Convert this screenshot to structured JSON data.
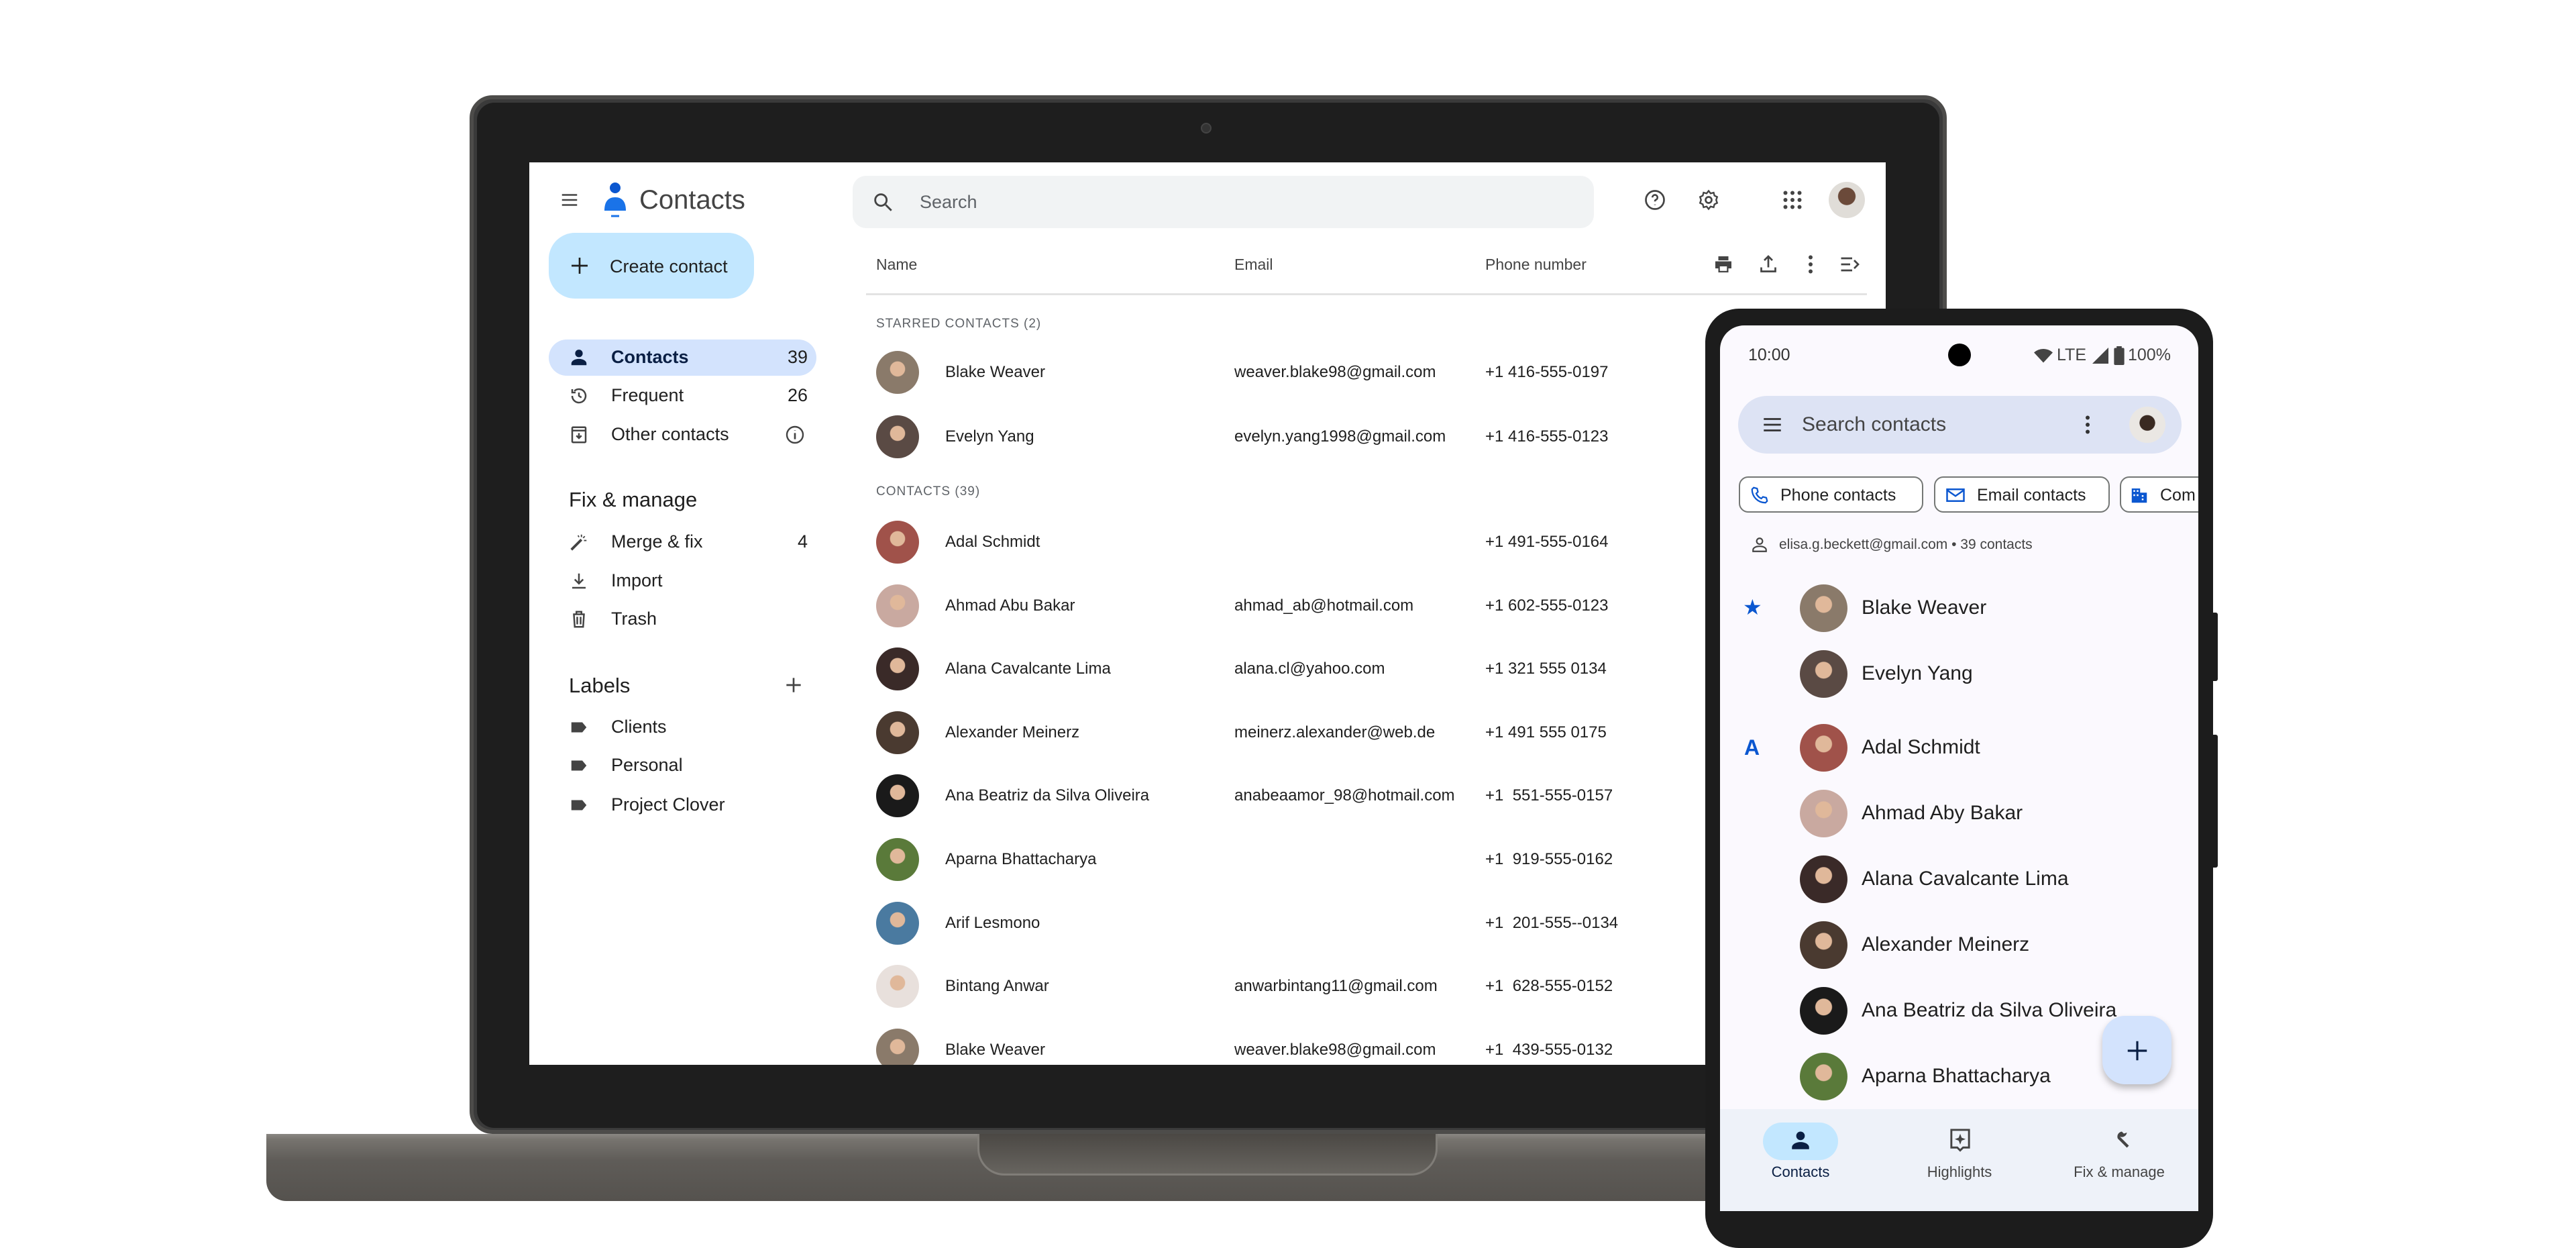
{
  "desktop": {
    "app_title": "Contacts",
    "search_placeholder": "Search",
    "create_contact": "Create contact",
    "nav": [
      {
        "label": "Contacts",
        "count": "39",
        "icon": "person-icon"
      },
      {
        "label": "Frequent",
        "count": "26",
        "icon": "history-icon"
      },
      {
        "label": "Other contacts",
        "icon": "archive-icon",
        "badge_icon": "info-icon"
      }
    ],
    "fix_heading": "Fix & manage",
    "fix_items": [
      {
        "label": "Merge & fix",
        "count": "4",
        "icon": "magic-wand-icon"
      },
      {
        "label": "Import",
        "icon": "download-icon"
      },
      {
        "label": "Trash",
        "icon": "trash-icon"
      }
    ],
    "labels_heading": "Labels",
    "labels": [
      "Clients",
      "Personal",
      "Project Clover"
    ],
    "columns": {
      "name": "Name",
      "email": "Email",
      "phone": "Phone number"
    },
    "starred_heading": "STARRED CONTACTS (2)",
    "contacts_heading": "CONTACTS (39)",
    "starred": [
      {
        "name": "Blake Weaver",
        "email": "weaver.blake98@gmail.com",
        "phone": "+1 416-555-0197",
        "tone": "#8a7a6a"
      },
      {
        "name": "Evelyn Yang",
        "email": "evelyn.yang1998@gmail.com",
        "phone": "+1 416-555-0123",
        "tone": "#5a4a44"
      }
    ],
    "contacts": [
      {
        "name": "Adal Schmidt",
        "email": "",
        "phone": "+1 491-555-0164",
        "tone": "#a0524a"
      },
      {
        "name": "Ahmad Abu Bakar",
        "email": "ahmad_ab@hotmail.com",
        "phone": "+1 602-555-0123",
        "tone": "#c9a9a0"
      },
      {
        "name": "Alana Cavalcante Lima",
        "email": "alana.cl@yahoo.com",
        "phone": "+1 321 555 0134",
        "tone": "#3a2a28"
      },
      {
        "name": "Alexander Meinerz",
        "email": "meinerz.alexander@web.de",
        "phone": "+1 491 555 0175",
        "tone": "#4a3a30"
      },
      {
        "name": "Ana Beatriz da Silva Oliveira",
        "email": "anabeaamor_98@hotmail.com",
        "phone": "+1  551-555-0157",
        "tone": "#1a1a1a"
      },
      {
        "name": "Aparna Bhattacharya",
        "email": "",
        "phone": "+1  919-555-0162",
        "tone": "#5a7a3a"
      },
      {
        "name": "Arif Lesmono",
        "email": "",
        "phone": "+1  201-555--0134",
        "tone": "#4a7aa0"
      },
      {
        "name": "Bintang Anwar",
        "email": "anwarbintang11@gmail.com",
        "phone": "+1  628-555-0152",
        "tone": "#e8e0dc"
      },
      {
        "name": "Blake Weaver",
        "email": "weaver.blake98@gmail.com",
        "phone": "+1  439-555-0132",
        "tone": "#8a7a6a"
      }
    ],
    "colors": {
      "accent": "#0b57d0",
      "create_bg": "#c2e7ff",
      "selected_bg": "#d3e3fd"
    }
  },
  "mobile": {
    "time": "10:00",
    "network": "LTE",
    "battery": "100%",
    "search_placeholder": "Search contacts",
    "chips": [
      {
        "label": "Phone contacts",
        "icon": "phone-icon"
      },
      {
        "label": "Email contacts",
        "icon": "mail-icon"
      },
      {
        "label": "Com",
        "icon": "building-icon"
      }
    ],
    "account": "elisa.g.beckett@gmail.com • 39 contacts",
    "section_star": "★",
    "section_a": "A",
    "list": [
      {
        "name": "Blake Weaver",
        "tone": "#8a7a6a"
      },
      {
        "name": "Evelyn Yang",
        "tone": "#5a4a44"
      },
      {
        "name": "Adal Schmidt",
        "tone": "#a0524a"
      },
      {
        "name": "Ahmad Aby Bakar",
        "tone": "#c9a9a0"
      },
      {
        "name": "Alana Cavalcante Lima",
        "tone": "#3a2a28"
      },
      {
        "name": "Alexander Meinerz",
        "tone": "#4a3a30"
      },
      {
        "name": "Ana Beatriz da Silva Oliveira",
        "tone": "#1a1a1a"
      },
      {
        "name": "Aparna Bhattacharya",
        "tone": "#5a7a3a"
      }
    ],
    "bottom_nav": [
      {
        "label": "Contacts",
        "icon": "person-icon",
        "active": true
      },
      {
        "label": "Highlights",
        "icon": "highlights-icon"
      },
      {
        "label": "Fix & manage",
        "icon": "wrench-icon"
      }
    ]
  }
}
